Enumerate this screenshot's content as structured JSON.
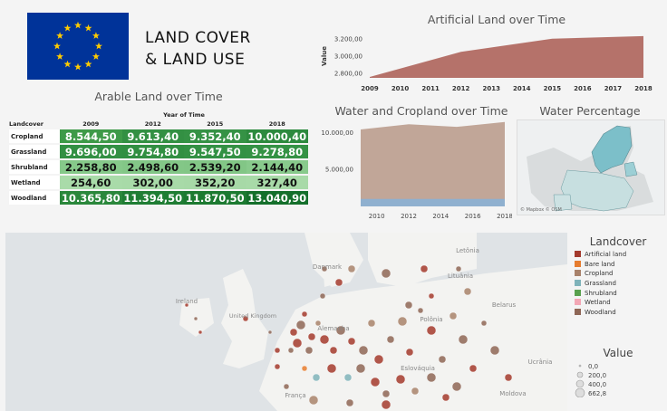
{
  "header": {
    "title_line1": "LAND COVER",
    "title_line2": "& LAND USE",
    "flag_color": "#003399",
    "star_color": "#FFCC00"
  },
  "arable": {
    "title": "Arable Land over Time",
    "year_header": "Year of Time",
    "landcover_header": "Landcover",
    "years": [
      "2009",
      "2012",
      "2015",
      "2018"
    ],
    "rows": [
      {
        "name": "Cropland",
        "values": [
          "8.544,50",
          "9.613,40",
          "9.352,40",
          "10.000,40"
        ],
        "colors": [
          "#3e9a48",
          "#339043",
          "#359245",
          "#2d8a3e"
        ],
        "text": "#ffffff"
      },
      {
        "name": "Grassland",
        "values": [
          "9.696,00",
          "9.754,80",
          "9.547,50",
          "9.278,80"
        ],
        "colors": [
          "#329043",
          "#318f42",
          "#339144",
          "#349245"
        ],
        "text": "#ffffff"
      },
      {
        "name": "Shrubland",
        "values": [
          "2.258,80",
          "2.498,60",
          "2.539,20",
          "2.144,40"
        ],
        "colors": [
          "#86c98a",
          "#83c787",
          "#82c686",
          "#88ca8c"
        ],
        "text": "#111111"
      },
      {
        "name": "Wetland",
        "values": [
          "254,60",
          "302,00",
          "352,20",
          "327,40"
        ],
        "colors": [
          "#a9dba9",
          "#a8daa8",
          "#a7d9a7",
          "#a8daa8"
        ],
        "text": "#111111"
      },
      {
        "name": "Woodland",
        "values": [
          "10.365,80",
          "11.394,50",
          "11.870,50",
          "13.040,90"
        ],
        "colors": [
          "#2a873b",
          "#1f7d34",
          "#1c7a31",
          "#146f2b"
        ],
        "text": "#ffffff"
      }
    ]
  },
  "artificial": {
    "title": "Artificial Land over Time",
    "ylabel": "Value",
    "color": "#b5726a"
  },
  "water_crop": {
    "title": "Water and Cropland over Time",
    "crop_color": "#c1a698",
    "water_color": "#8fb0cf"
  },
  "water_pct": {
    "title": "Water Percentage",
    "attribution": "© Mapbox © OSM"
  },
  "map": {
    "labels": [
      "United Kingdom",
      "Ireland",
      "Danmark",
      "Polônia",
      "Belarus",
      "Alemanha",
      "França",
      "Ucrânia",
      "Letônia",
      "Lituânia",
      "Eslováquia",
      "Moldova"
    ]
  },
  "legend": {
    "title": "Landcover",
    "items": [
      {
        "label": "Artificial land",
        "color": "#a33a2d"
      },
      {
        "label": "Bare land",
        "color": "#e67c2f"
      },
      {
        "label": "Cropland",
        "color": "#a8826b"
      },
      {
        "label": "Grassland",
        "color": "#7fb3ba"
      },
      {
        "label": "Shrubland",
        "color": "#59a14f"
      },
      {
        "label": "Wetland",
        "color": "#f3a7b5"
      },
      {
        "label": "Woodland",
        "color": "#8e6656"
      }
    ],
    "value_title": "Value",
    "values": [
      "0,0",
      "200,0",
      "400,0",
      "662,8"
    ]
  },
  "chart_data": [
    {
      "type": "area",
      "title": "Artificial Land over Time",
      "ylabel": "Value",
      "x": [
        2009,
        2012,
        2015,
        2018
      ],
      "series": [
        {
          "values": [
            2760,
            3050,
            3200,
            3230
          ]
        }
      ],
      "ylim": [
        2750,
        3250
      ],
      "yticks": [
        "2.800,00",
        "3.000,00",
        "3.200,00"
      ],
      "xticks": [
        "2009",
        "2010",
        "2011",
        "2012",
        "2013",
        "2014",
        "2015",
        "2016",
        "2017",
        "2018"
      ]
    },
    {
      "type": "area",
      "title": "Water and Cropland over Time",
      "x": [
        2009,
        2012,
        2015,
        2018
      ],
      "series": [
        {
          "values": [
            10400,
            11100,
            10750,
            11400
          ]
        },
        {
          "values": [
            1000,
            1000,
            1000,
            1000
          ]
        }
      ],
      "ylim": [
        0,
        11500
      ],
      "yticks": [
        "5.000,00",
        "10.000,00"
      ],
      "xticks": [
        "2010",
        "2012",
        "2014",
        "2016",
        "2018"
      ]
    }
  ]
}
